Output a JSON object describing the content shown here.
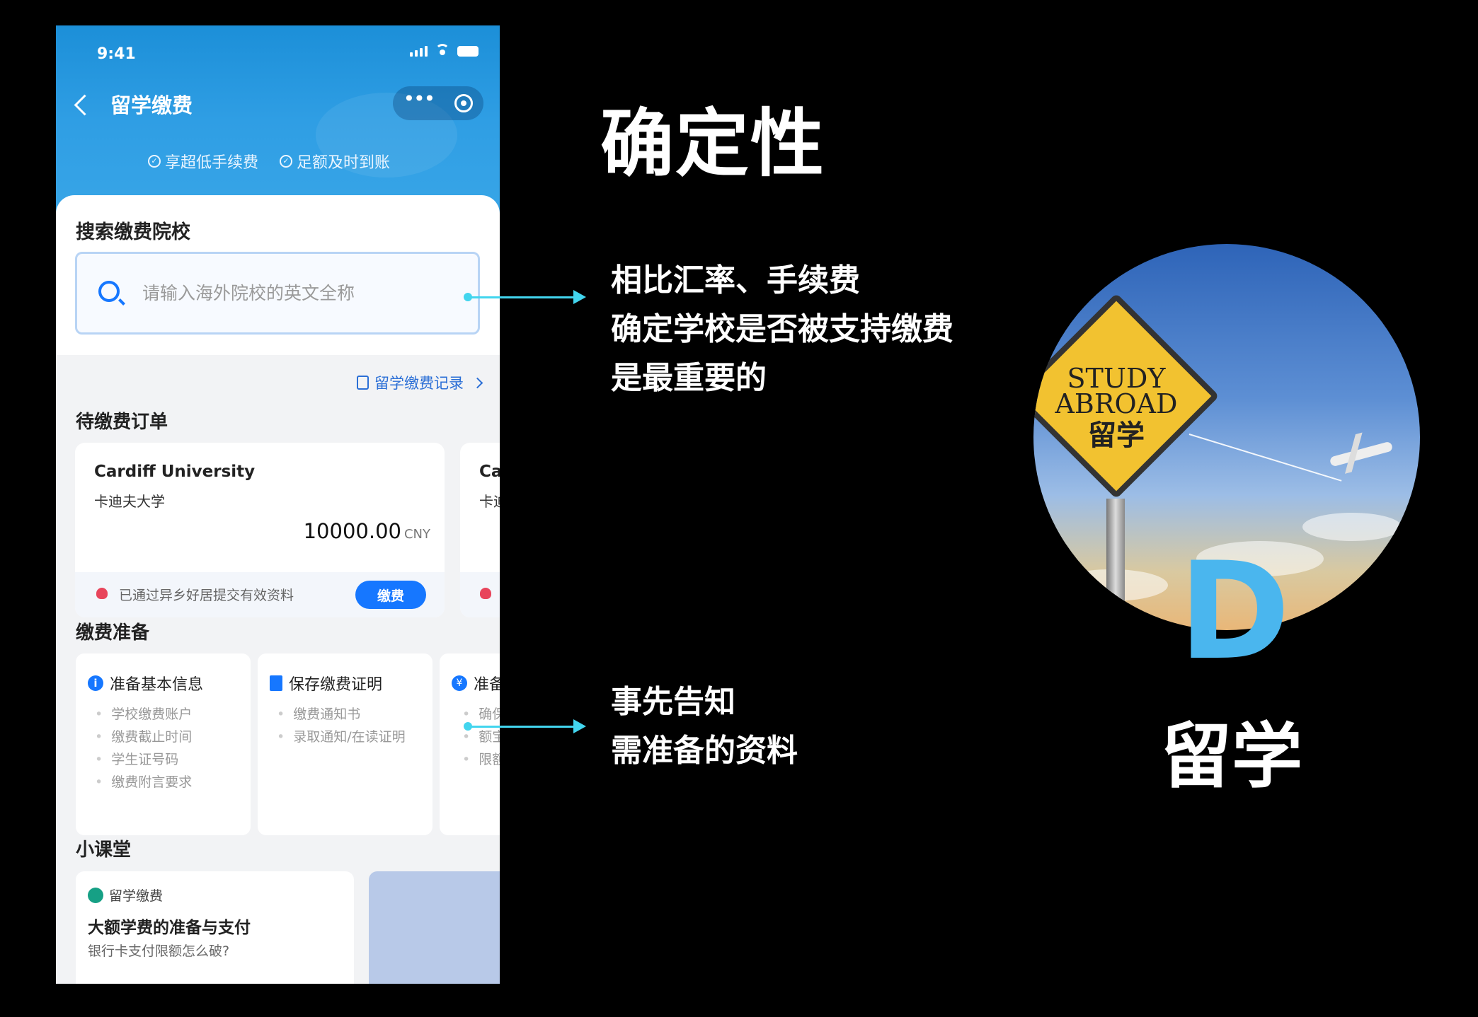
{
  "phone": {
    "status_time": "9:41",
    "nav_title": "留学缴费",
    "badges": [
      "享超低手续费",
      "足额及时到账"
    ],
    "search": {
      "title": "搜索缴费院校",
      "placeholder": "请输入海外院校的英文全称"
    },
    "record_link": "留学缴费记录",
    "pending_title": "待缴费订单",
    "orders": [
      {
        "name": "Cardiff University",
        "name_cn": "卡迪夫大学",
        "amount": "10000.00",
        "currency": "CNY",
        "note": "已通过异乡好居提交有效资料",
        "pay_label": "缴费"
      },
      {
        "name": "Ca",
        "name_cn": "卡迪"
      }
    ],
    "prep_title": "缴费准备",
    "prep_cards": [
      {
        "icon": "info-icon",
        "title": "准备基本信息",
        "items": [
          "学校缴费账户",
          "缴费截止时间",
          "学生证号码",
          "缴费附言要求"
        ]
      },
      {
        "icon": "document-icon",
        "title": "保存缴费证明",
        "items": [
          "缴费通知书",
          "录取通知/在读证明"
        ]
      },
      {
        "icon": "yen-icon",
        "title": "准备",
        "items": [
          "确保",
          "额宝",
          "限额"
        ]
      }
    ],
    "class_title": "小课堂",
    "class_card": {
      "tag": "留学缴费",
      "title": "大额学费的准备与支付",
      "subtitle": "银行卡支付限额怎么破?"
    }
  },
  "slide": {
    "headline": "确定性",
    "annotation_top": [
      "相比汇率、手续费",
      "确定学校是否被支持缴费",
      "是最重要的"
    ],
    "annotation_bottom": [
      "事先告知",
      "需准备的资料"
    ],
    "accent_color": "#42d5ee"
  },
  "logo": {
    "sign_en": [
      "STUDY",
      "ABROAD"
    ],
    "sign_cn": "留学",
    "letter": "D",
    "name": "留学",
    "letter_color": "#4ab6ee"
  }
}
